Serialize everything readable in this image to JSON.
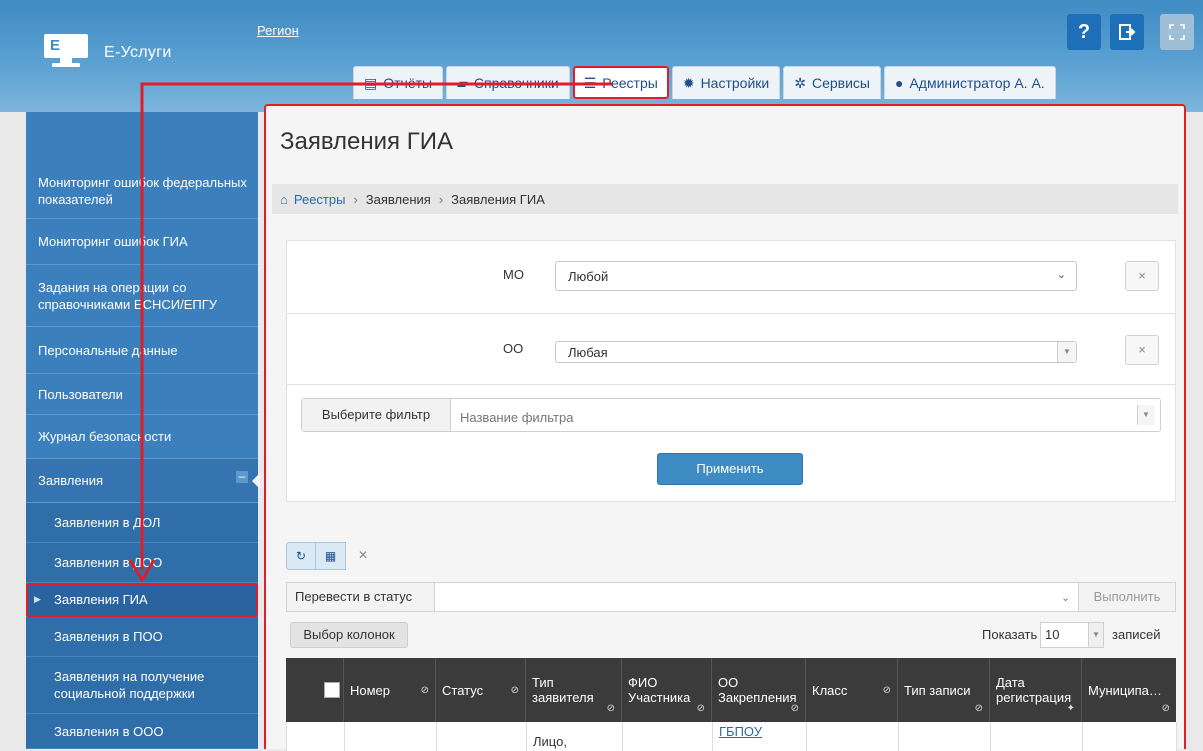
{
  "header": {
    "app_title": "Е-Услуги",
    "region_link": "Регион",
    "help_label": "?",
    "exit_label": "⇥",
    "fullscreen_label": "⤢"
  },
  "tabs": [
    {
      "label": "Отчёты",
      "icon": "report-icon"
    },
    {
      "label": "Справочники",
      "icon": "book-icon"
    },
    {
      "label": "Реестры",
      "icon": "list-icon",
      "active": true
    },
    {
      "label": "Настройки",
      "icon": "gear-icon"
    },
    {
      "label": "Сервисы",
      "icon": "gears-icon"
    },
    {
      "label": "Администратор А. А.",
      "icon": "user-icon"
    }
  ],
  "sidebar": {
    "items": [
      {
        "label": "Мониторинг ошибок федеральных показателей"
      },
      {
        "label": "Мониторинг ошибок ГИА"
      },
      {
        "label": "Задания на операции со справочниками ЕСНСИ/ЕПГУ"
      },
      {
        "label": "Персональные данные"
      },
      {
        "label": "Пользователи"
      },
      {
        "label": "Журнал безопасности"
      },
      {
        "label": "Заявления",
        "expanded": true,
        "collapse": "–"
      },
      {
        "label": "Заявления в ДОЛ",
        "sub": true
      },
      {
        "label": "Заявления в ДОО",
        "sub": true
      },
      {
        "label": "Заявления ГИА",
        "sub": true,
        "active": true
      },
      {
        "label": "Заявления в ПОО",
        "sub": true
      },
      {
        "label": "Заявления на получение социальной поддержки",
        "sub": true
      },
      {
        "label": "Заявления в ООО",
        "sub": true
      }
    ]
  },
  "main": {
    "title": "Заявления ГИА",
    "breadcrumb": [
      "Реестры",
      "Заявления",
      "Заявления ГИА"
    ],
    "filters": {
      "mo_label": "МО",
      "mo_value": "Любой",
      "oo_label": "ОО",
      "oo_value": "Любая",
      "filter_label": "Выберите фильтр",
      "filter_placeholder": "Название фильтра",
      "apply_label": "Применить",
      "clear_label": "×"
    },
    "grid": {
      "status_label": "Перевести в статус",
      "execute_label": "Выполнить",
      "columns_label": "Выбор колонок",
      "show_label": "Показать",
      "show_value": "10",
      "records_label": "записей",
      "columns": [
        "Номер",
        "Статус",
        "Тип заявителя",
        "ФИО Участника",
        "ОО Закрепления",
        "Класс",
        "Тип записи",
        "Дата регистрация",
        "Муниципа…"
      ],
      "first_row": {
        "applicant_type": "Лицо,",
        "school": "ГБПОУ"
      }
    }
  },
  "colors": {
    "accent": "#3b7fbd",
    "highlight": "#e01e2a"
  }
}
